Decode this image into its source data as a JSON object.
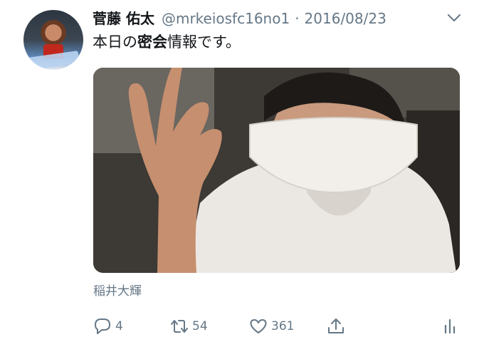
{
  "tweet": {
    "author_name": "菅藤 佑太",
    "handle": "@mrkeiosfc16no1",
    "separator": "·",
    "date": "2016/08/23",
    "text_before": "本日の",
    "text_bold": "密会",
    "text_after": "情報です。",
    "photo_caption": "稲井大輝"
  },
  "actions": {
    "reply_count": "4",
    "retweet_count": "54",
    "like_count": "361"
  },
  "icons": {
    "reply": "reply-icon",
    "retweet": "retweet-icon",
    "like": "heart-icon",
    "share": "share-icon",
    "analytics": "analytics-icon",
    "more": "chevron-down-icon"
  },
  "colors": {
    "text": "#14171a",
    "secondary": "#657786",
    "background": "#ffffff"
  }
}
